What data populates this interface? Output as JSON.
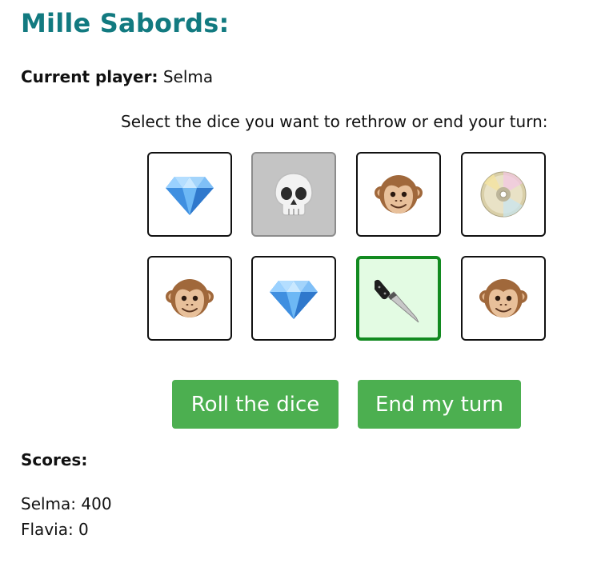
{
  "game": {
    "title": "Mille Sabords:"
  },
  "current": {
    "label": "Current player:",
    "player": "Selma"
  },
  "instruction": "Select the dice you want to rethrow or end your turn:",
  "dice": [
    {
      "face": "diamond-icon",
      "state": "normal"
    },
    {
      "face": "skull-icon",
      "state": "locked"
    },
    {
      "face": "monkey-icon",
      "state": "normal"
    },
    {
      "face": "coin-icon",
      "state": "normal"
    },
    {
      "face": "monkey-icon",
      "state": "normal"
    },
    {
      "face": "diamond-icon",
      "state": "normal"
    },
    {
      "face": "knife-icon",
      "state": "selected"
    },
    {
      "face": "monkey-icon",
      "state": "normal"
    }
  ],
  "buttons": {
    "roll": "Roll the dice",
    "end": "End my turn"
  },
  "scores": {
    "title": "Scores:",
    "lines": [
      "Selma: 400",
      "Flavia: 0"
    ]
  },
  "colors": {
    "title": "#127a80",
    "button": "#4caf50",
    "selected_border": "#128a20",
    "selected_bg": "#e3fbe3",
    "locked_bg": "#c4c4c4"
  }
}
